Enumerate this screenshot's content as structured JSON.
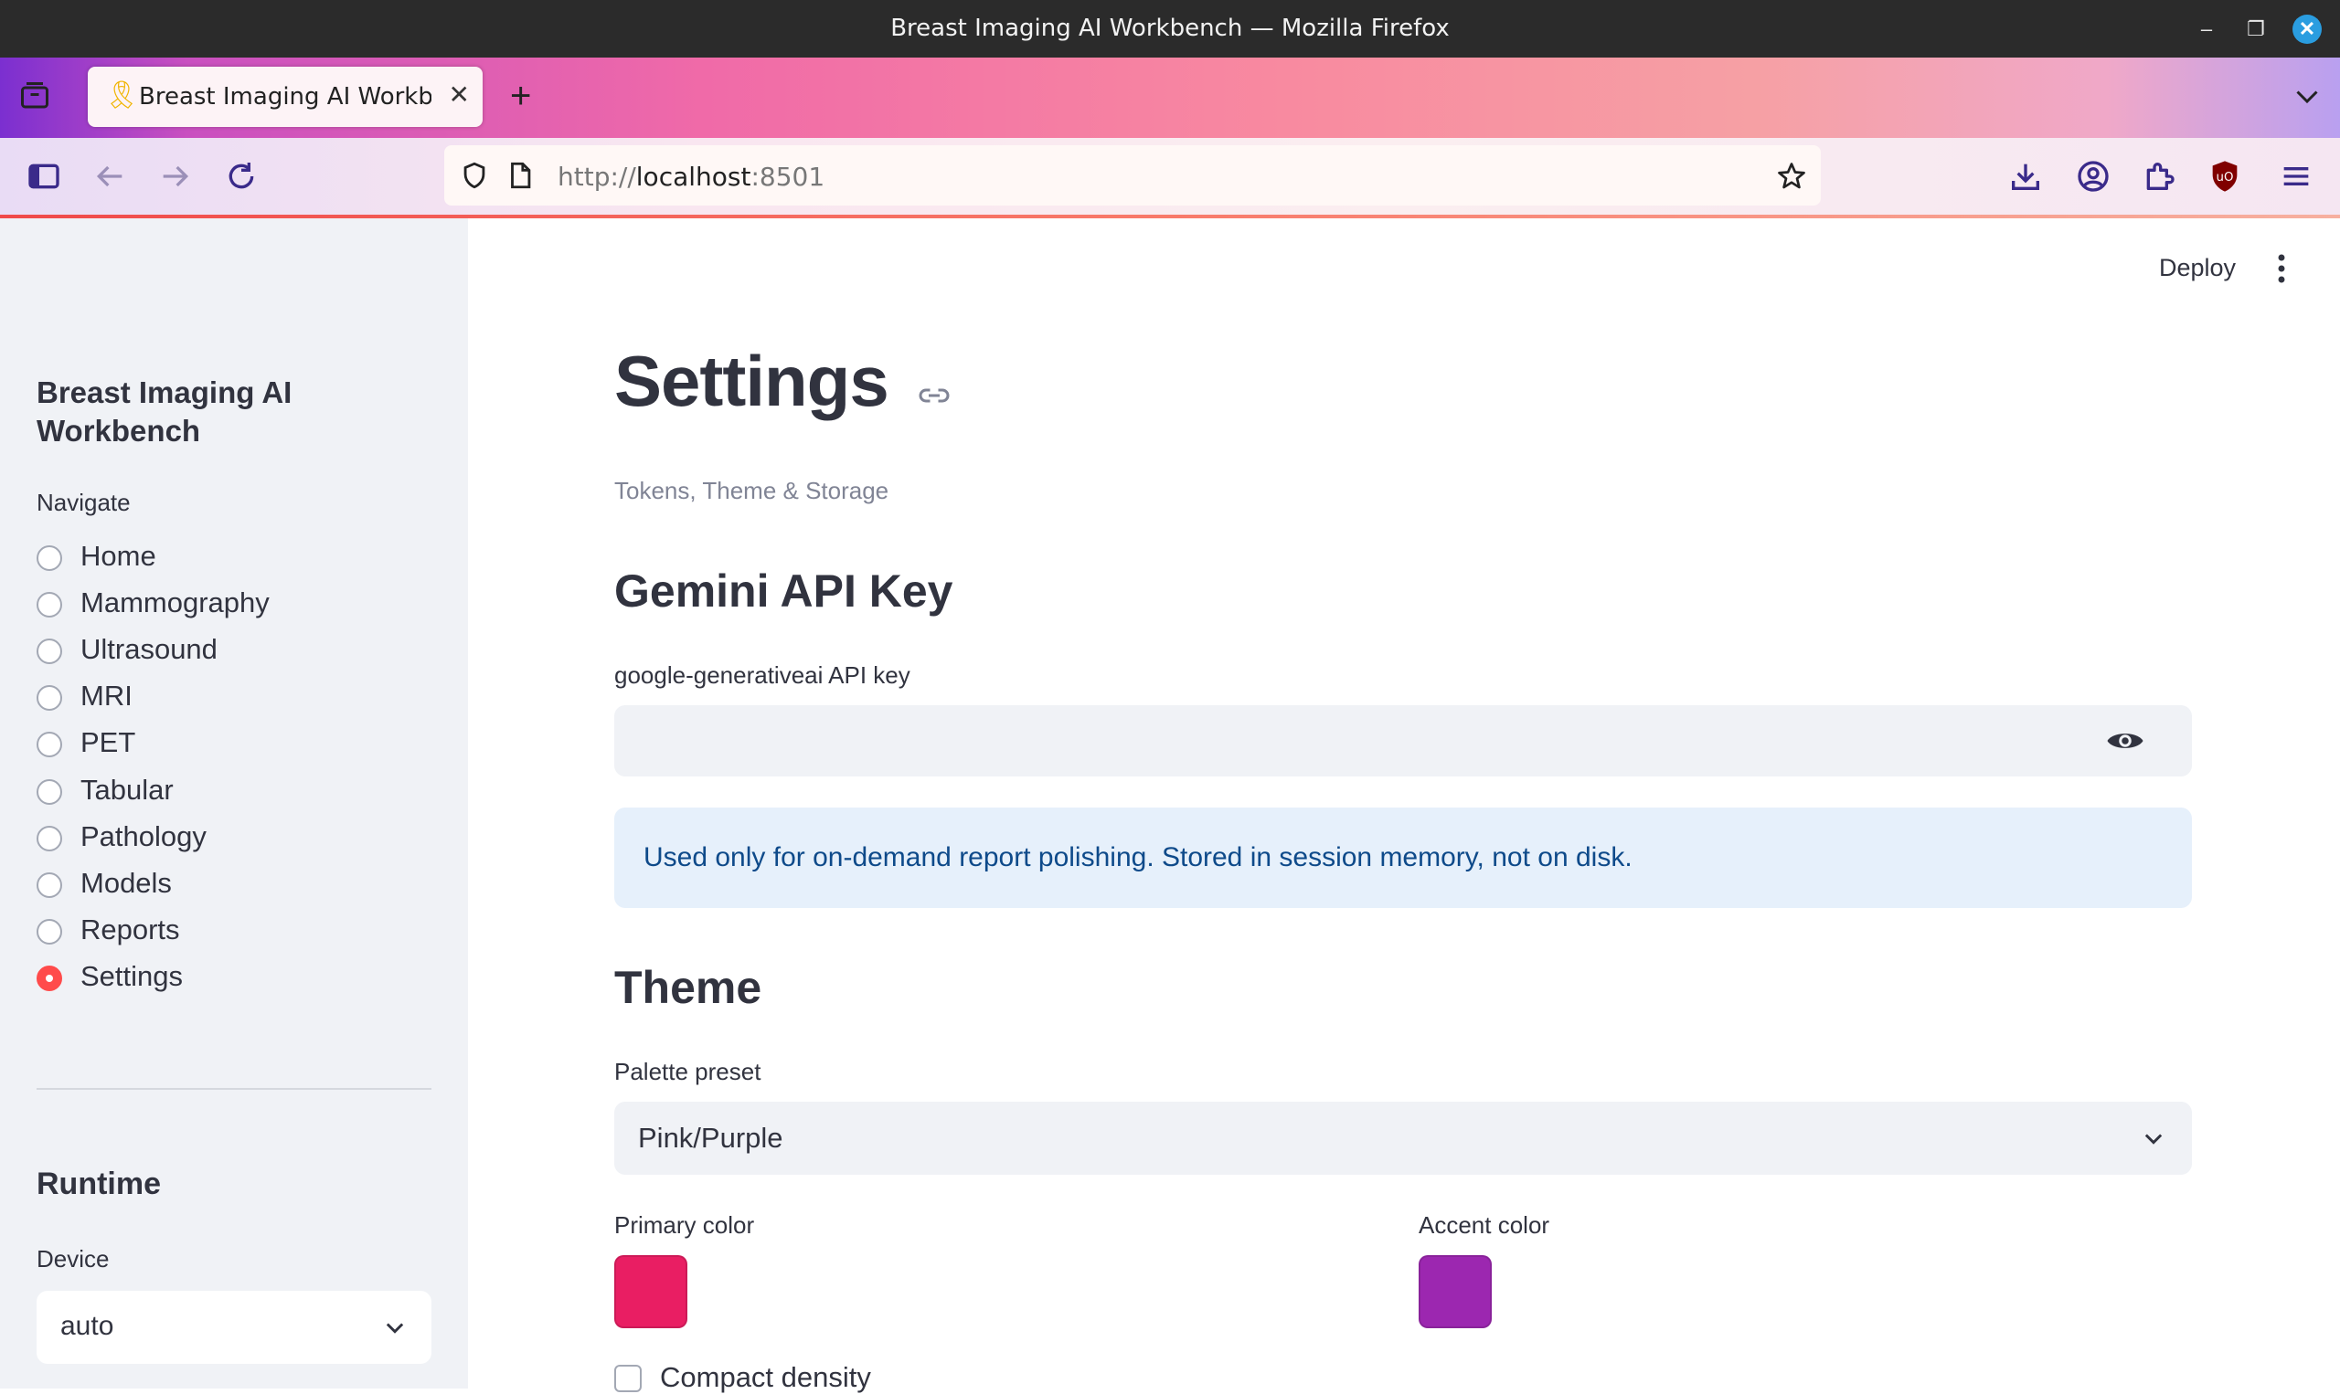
{
  "window": {
    "title": "Breast Imaging AI Workbench — Mozilla Firefox",
    "minimize_glyph": "–",
    "maximize_glyph": "❐",
    "close_glyph": "✕"
  },
  "browser": {
    "tab_title": "Breast Imaging AI Workbench",
    "tab_favicon": "🎗",
    "tab_close_glyph": "✕",
    "new_tab_glyph": "+",
    "url_scheme": "http://",
    "url_host": "localhost",
    "url_port": ":8501"
  },
  "sidebar": {
    "app_title": "Breast Imaging AI Workbench",
    "navigate_label": "Navigate",
    "nav_items": [
      {
        "label": "Home",
        "selected": false
      },
      {
        "label": "Mammography",
        "selected": false
      },
      {
        "label": "Ultrasound",
        "selected": false
      },
      {
        "label": "MRI",
        "selected": false
      },
      {
        "label": "PET",
        "selected": false
      },
      {
        "label": "Tabular",
        "selected": false
      },
      {
        "label": "Pathology",
        "selected": false
      },
      {
        "label": "Models",
        "selected": false
      },
      {
        "label": "Reports",
        "selected": false
      },
      {
        "label": "Settings",
        "selected": true
      }
    ],
    "runtime_heading": "Runtime",
    "device_label": "Device",
    "device_value": "auto"
  },
  "header": {
    "deploy_label": "Deploy"
  },
  "main": {
    "title": "Settings",
    "caption": "Tokens, Theme & Storage",
    "gemini_heading": "Gemini API Key",
    "api_key_label": "google-generativeai API key",
    "api_key_value": "",
    "info_text": "Used only for on-demand report polishing. Stored in session memory, not on disk.",
    "theme_heading": "Theme",
    "palette_label": "Palette preset",
    "palette_value": "Pink/Purple",
    "primary_label": "Primary color",
    "accent_label": "Accent color",
    "compact_label": "Compact density",
    "compact_checked": false
  },
  "colors": {
    "primary": "#e91e63",
    "accent": "#9c27b0",
    "radio_selected": "#ff4b4b",
    "info_bg": "#e6f0fb",
    "info_text": "#0e4a8a"
  }
}
